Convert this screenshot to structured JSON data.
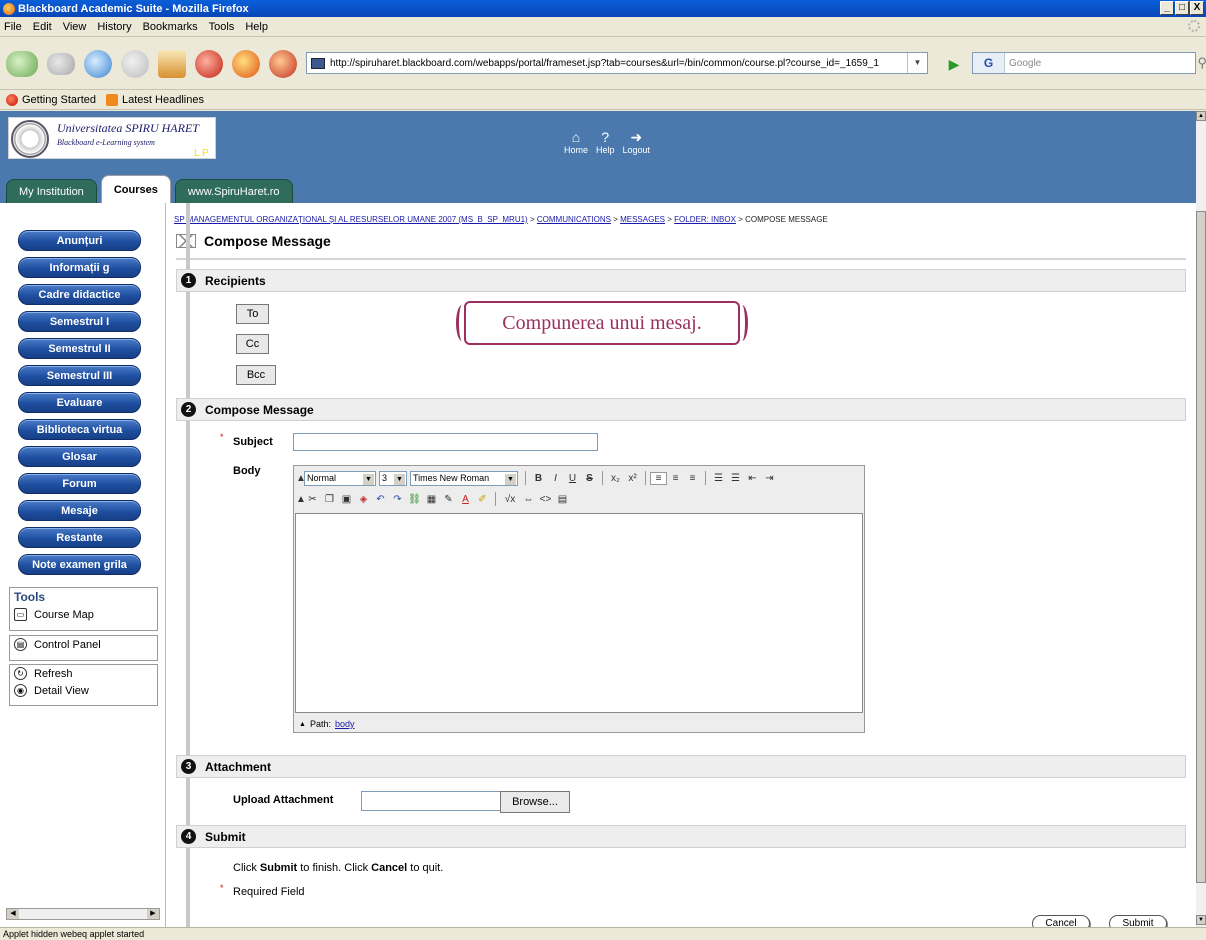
{
  "window": {
    "title": "Blackboard Academic Suite - Mozilla Firefox",
    "min": "_",
    "max": "□",
    "close": "X"
  },
  "menu": [
    "File",
    "Edit",
    "View",
    "History",
    "Bookmarks",
    "Tools",
    "Help"
  ],
  "toolbar": {
    "url": "http://spiruharet.blackboard.com/webapps/portal/frameset.jsp?tab=courses&url=/bin/common/course.pl?course_id=_1659_1",
    "search_placeholder": "Google",
    "search_engine_glyph": "G"
  },
  "bookmarks": [
    "Getting Started",
    "Latest Headlines"
  ],
  "header": {
    "logo_line1": "Universitatea SPIRU HARET",
    "logo_line2": "Blackboard e-Learning system",
    "lp": "L P",
    "links": [
      {
        "icon": "home-icon",
        "glyph": "⌂",
        "label": "Home"
      },
      {
        "icon": "help-icon",
        "glyph": "?",
        "label": "Help"
      },
      {
        "icon": "logout-icon",
        "glyph": "➜",
        "label": "Logout"
      }
    ],
    "tabs": [
      "My Institution",
      "Courses",
      "www.SpiruHaret.ro"
    ],
    "active_tab": "Courses"
  },
  "left_nav": {
    "items": [
      "Anunțuri",
      "Informații g",
      "Cadre didactice",
      "Semestrul I",
      "Semestrul II",
      "Semestrul III",
      "Evaluare",
      "Biblioteca virtua",
      "Glosar",
      "Forum",
      "Mesaje",
      "Restante",
      "Note examen grila"
    ],
    "tools_title": "Tools",
    "tools": [
      "Course Map",
      "Control Panel",
      "Refresh",
      "Detail View"
    ]
  },
  "breadcrumb": {
    "items": [
      "SP MANAGEMENTUL ORGANIZAȚIONAL ȘI AL RESURSELOR UMANE 2007 (MS_B_SP_MRU1)",
      "COMMUNICATIONS",
      "MESSAGES",
      "FOLDER: INBOX"
    ],
    "current": "COMPOSE MESSAGE",
    "sep": ">"
  },
  "page_title": "Compose Message",
  "sections": [
    {
      "num": "1",
      "title": "Recipients"
    },
    {
      "num": "2",
      "title": "Compose Message"
    },
    {
      "num": "3",
      "title": "Attachment"
    },
    {
      "num": "4",
      "title": "Submit"
    }
  ],
  "recipients": {
    "to": "To",
    "cc": "Cc",
    "bcc": "Bcc"
  },
  "banner": "Compunerea unui mesaj.",
  "compose": {
    "subject_label": "Subject",
    "subject_value": "",
    "body_label": "Body",
    "format_value": "Normal",
    "size_value": "3",
    "font_value": "Times New Roman",
    "path_label": "Path:",
    "path_link": "body",
    "required_mark": "*"
  },
  "attachment": {
    "label": "Upload Attachment",
    "browse": "Browse..."
  },
  "submit_section": {
    "line1_a": "Click ",
    "line1_b": "Submit",
    "line1_c": " to finish. Click ",
    "line1_d": "Cancel",
    "line1_e": " to quit.",
    "required_field": "Required Field",
    "cancel": "Cancel",
    "submit": "Submit"
  },
  "status": "Applet hidden webeq applet started"
}
